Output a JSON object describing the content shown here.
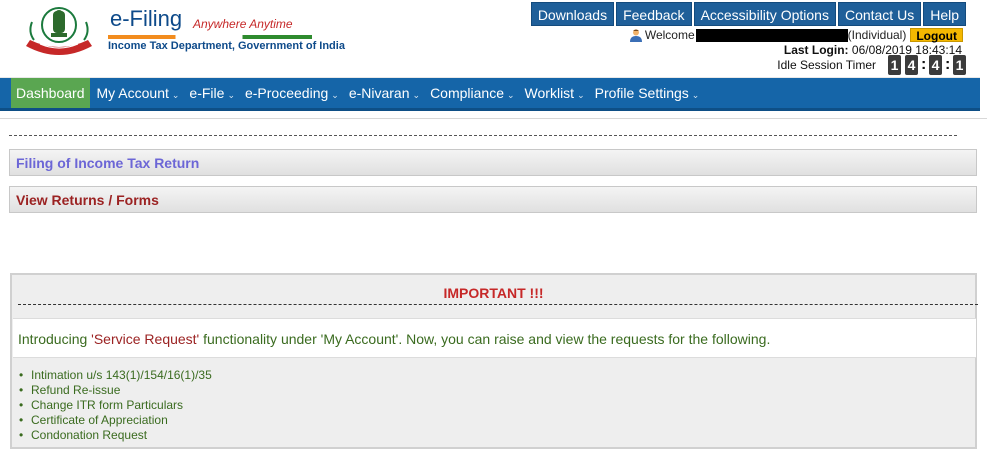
{
  "brand": {
    "title": "e-Filing",
    "tagline": "Anywhere Anytime",
    "department": "Income Tax Department, Government of India",
    "emblem_icon": "india-state-emblem-icon"
  },
  "topnav": {
    "items": [
      "Downloads",
      "Feedback",
      "Accessibility Options",
      "Contact Us",
      "Help"
    ]
  },
  "user": {
    "welcome_label": "Welcome",
    "user_icon": "user-avatar-icon",
    "user_type": "(Individual)",
    "logout_label": "Logout",
    "last_login_label": "Last Login:",
    "last_login_value": "06/08/2019 18:43:14",
    "idle_timer_label": "Idle Session Timer",
    "timer_digits": [
      "1",
      "4",
      "4",
      "1"
    ]
  },
  "mainnav": {
    "items": [
      {
        "label": "Dashboard",
        "active": true
      },
      {
        "label": "My Account",
        "dropdown": true
      },
      {
        "label": "e-File",
        "dropdown": true
      },
      {
        "label": "e-Proceeding",
        "dropdown": true
      },
      {
        "label": "e-Nivaran",
        "dropdown": true
      },
      {
        "label": "Compliance",
        "dropdown": true
      },
      {
        "label": "Worklist",
        "dropdown": true
      },
      {
        "label": "Profile Settings",
        "dropdown": true
      }
    ],
    "dropdown_glyph": "⌄"
  },
  "panels": {
    "filing_title": "Filing of Income Tax Return",
    "view_title": "View Returns / Forms"
  },
  "important": {
    "title": "IMPORTANT !!!",
    "intro_prefix": "Introducing ",
    "intro_highlight": "'Service Request'",
    "intro_suffix": " functionality under 'My Account'. Now, you can raise and view the requests for the following.",
    "items": [
      "Intimation u/s 143(1)/154/16(1)/35",
      "Refund Re-issue",
      "Change ITR form Particulars",
      "Certificate of Appreciation",
      "Condonation Request"
    ]
  },
  "colors": {
    "nav_blue": "#1565a8",
    "dashboard_green": "#5aa651",
    "logout_yellow": "#f5b800",
    "alert_red": "#c62828",
    "text_green": "#3a6b1f"
  }
}
